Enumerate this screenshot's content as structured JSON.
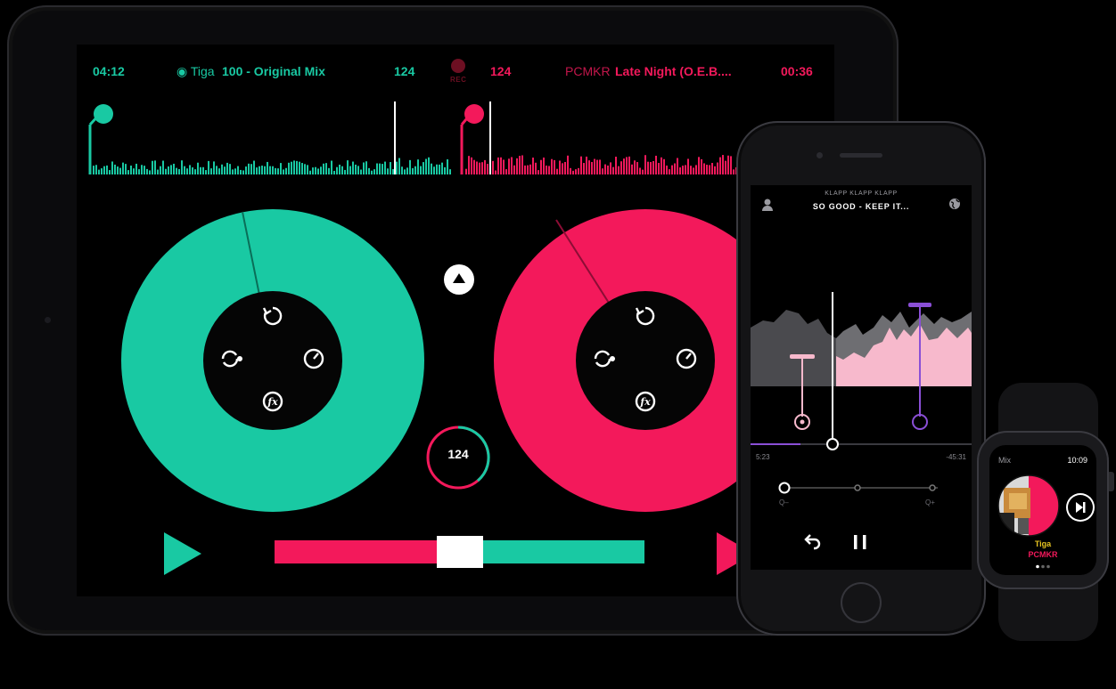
{
  "ipad": {
    "deck_a": {
      "elapsed": "04:12",
      "artist": "Tiga",
      "title": "100 - Original Mix",
      "bpm": "124",
      "color": "#19c9a3"
    },
    "deck_b": {
      "bpm": "124",
      "artist": "PCMKR",
      "title": "Late Night (O.E.B....",
      "remaining": "00:36",
      "color": "#f3195b"
    },
    "rec_label": "REC",
    "center_bpm": "124",
    "crossfader_position": 0.5,
    "hub_icons": [
      "sync-icon",
      "loop-icon",
      "tempo-gauge-icon",
      "fx-icon"
    ]
  },
  "iphone": {
    "artist": "KLAPP KLAPP KLAPP",
    "title": "SO GOOD - KEEP IT...",
    "elapsed": "5:23",
    "remaining": "-45:31",
    "zoom_out_label": "Q–",
    "zoom_in_label": "Q+",
    "progress": 0.34
  },
  "watch": {
    "app_label": "Mix",
    "time": "10:09",
    "track_1": "Tiga",
    "track_2": "PCMKR"
  }
}
